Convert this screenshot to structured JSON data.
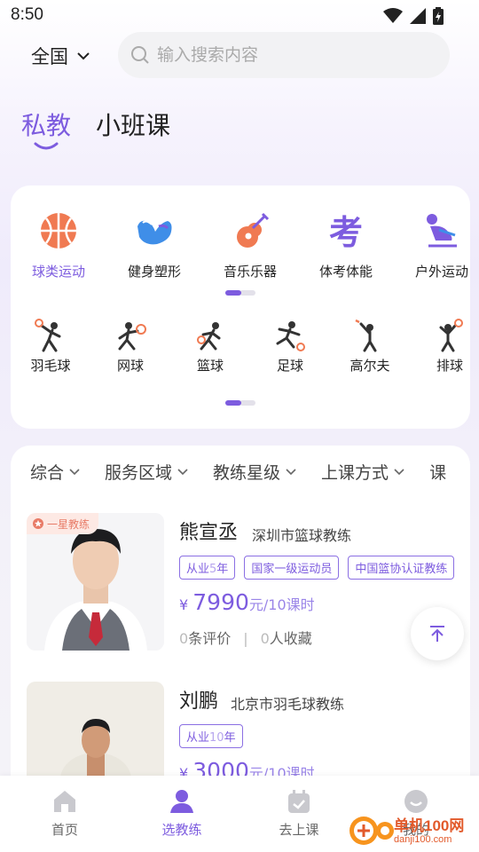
{
  "status_bar": {
    "time": "8:50"
  },
  "header": {
    "region": "全国",
    "search_placeholder": "输入搜索内容"
  },
  "mode_tabs": [
    {
      "label": "私教",
      "active": true
    },
    {
      "label": "小班课",
      "active": false
    }
  ],
  "categories": [
    {
      "label": "球类运动",
      "icon": "basketball-icon",
      "active": true
    },
    {
      "label": "健身塑形",
      "icon": "muscle-icon",
      "active": false
    },
    {
      "label": "音乐乐器",
      "icon": "guitar-icon",
      "active": false
    },
    {
      "label": "体考体能",
      "icon": "exam-icon",
      "active": false
    },
    {
      "label": "户外运动",
      "icon": "skating-icon",
      "active": false
    }
  ],
  "sports": [
    {
      "label": "羽毛球",
      "icon": "badminton-player-icon"
    },
    {
      "label": "网球",
      "icon": "tennis-player-icon"
    },
    {
      "label": "篮球",
      "icon": "basketball-player-icon"
    },
    {
      "label": "足球",
      "icon": "soccer-player-icon"
    },
    {
      "label": "高尔夫",
      "icon": "golf-player-icon"
    },
    {
      "label": "排球",
      "icon": "volleyball-player-icon"
    }
  ],
  "filters": [
    "综合",
    "服务区域",
    "教练星级",
    "上课方式",
    "课"
  ],
  "coaches": [
    {
      "badge": "一星教练",
      "name": "熊宣丞",
      "title": "深圳市篮球教练",
      "tags": [
        {
          "pre": "从业",
          "num": "5",
          "post": "年"
        },
        {
          "pre": "国家一级运动员",
          "num": "",
          "post": ""
        },
        {
          "pre": "中国篮协认证教练",
          "num": "",
          "post": ""
        }
      ],
      "price": {
        "currency": "¥",
        "amount": "7990",
        "unit": "元/10课时"
      },
      "reviews": {
        "count": "0",
        "label": "条评价"
      },
      "favorites": {
        "count": "0",
        "label": "人收藏"
      }
    },
    {
      "name": "刘鹏",
      "title": "北京市羽毛球教练",
      "tags": [
        {
          "pre": "从业",
          "num": "10",
          "post": "年"
        }
      ],
      "price": {
        "currency": "¥",
        "amount": "3000",
        "unit": "元/10课时"
      }
    }
  ],
  "bottom_nav": [
    {
      "label": "首页",
      "icon": "home-icon",
      "active": false
    },
    {
      "label": "选教练",
      "icon": "person-icon",
      "active": true
    },
    {
      "label": "去上课",
      "icon": "calendar-icon",
      "active": false
    },
    {
      "label": "我的",
      "icon": "profile-icon",
      "active": false
    }
  ],
  "watermark": {
    "text": "单机100网",
    "url": "danji100.com"
  },
  "colors": {
    "accent": "#7d5cdf",
    "orange": "#f07a52",
    "blue": "#3f8ee8"
  }
}
